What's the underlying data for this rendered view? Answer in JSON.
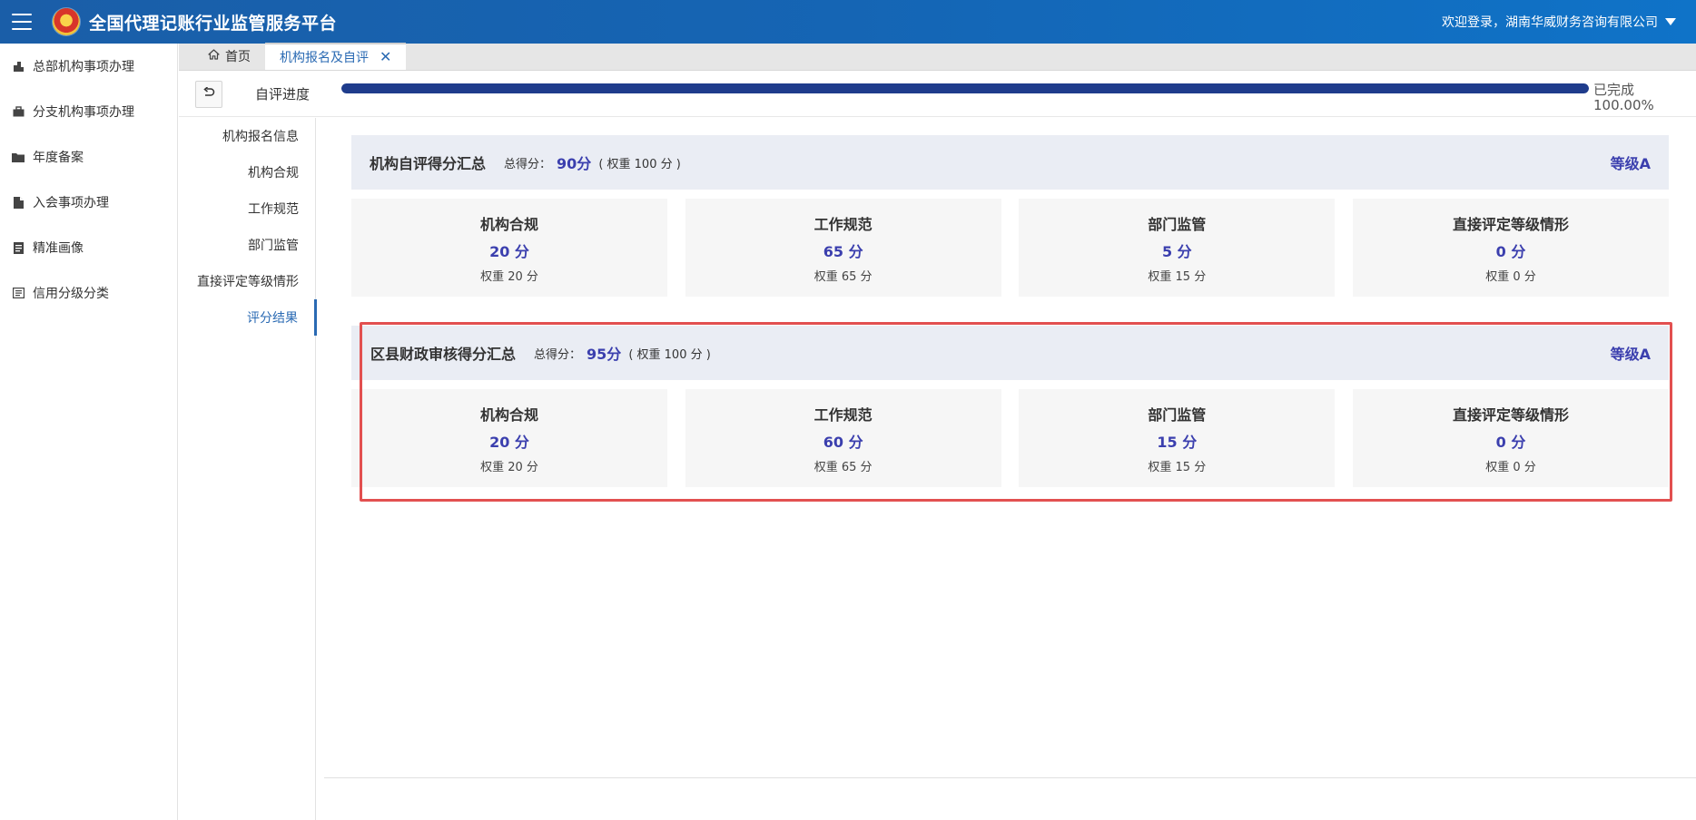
{
  "header": {
    "title": "全国代理记账行业监管服务平台",
    "welcome": "欢迎登录，湖南华威财务咨询有限公司"
  },
  "sidebar": {
    "items": [
      {
        "label": "总部机构事项办理",
        "icon": "building-icon"
      },
      {
        "label": "分支机构事项办理",
        "icon": "briefcase-icon"
      },
      {
        "label": "年度备案",
        "icon": "folder-icon"
      },
      {
        "label": "入会事项办理",
        "icon": "file-icon"
      },
      {
        "label": "精准画像",
        "icon": "document-list-icon"
      },
      {
        "label": "信用分级分类",
        "icon": "list-icon"
      }
    ]
  },
  "tabs": [
    {
      "label": "首页",
      "icon": "home-icon"
    },
    {
      "label": "机构报名及自评",
      "icon": "close-icon"
    }
  ],
  "progress": {
    "label": "自评进度",
    "status": "已完成",
    "percent_text": "100.00%",
    "value": 1.0
  },
  "section_nav": {
    "items": [
      "机构报名信息",
      "机构合规",
      "工作规范",
      "部门监管",
      "直接评定等级情形",
      "评分结果"
    ],
    "active_index": 5
  },
  "self_eval": {
    "title": "机构自评得分汇总",
    "total_label": "总得分：",
    "total_value": "90分",
    "weight_note": "( 权重 100 分 )",
    "grade": "等级A",
    "cards": [
      {
        "title": "机构合规",
        "score": "20 分",
        "weight": "权重 20 分"
      },
      {
        "title": "工作规范",
        "score": "65 分",
        "weight": "权重 65 分"
      },
      {
        "title": "部门监管",
        "score": "5 分",
        "weight": "权重 15 分"
      },
      {
        "title": "直接评定等级情形",
        "score": "0 分",
        "weight": "权重 0 分"
      }
    ]
  },
  "county_review": {
    "title": "区县财政审核得分汇总",
    "total_label": "总得分：",
    "total_value": "95分",
    "weight_note": "( 权重 100 分 )",
    "grade": "等级A",
    "cards": [
      {
        "title": "机构合规",
        "score": "20 分",
        "weight": "权重 20 分"
      },
      {
        "title": "工作规范",
        "score": "60 分",
        "weight": "权重 65 分"
      },
      {
        "title": "部门监管",
        "score": "15 分",
        "weight": "权重 15 分"
      },
      {
        "title": "直接评定等级情形",
        "score": "0 分",
        "weight": "权重 0 分"
      }
    ]
  },
  "colors": {
    "header_bg": "#1565b4",
    "accent_score": "#3b3fae",
    "progress_fill": "#1f3c8c",
    "highlight_border": "#e25050",
    "link_blue": "#2a6ab3"
  }
}
